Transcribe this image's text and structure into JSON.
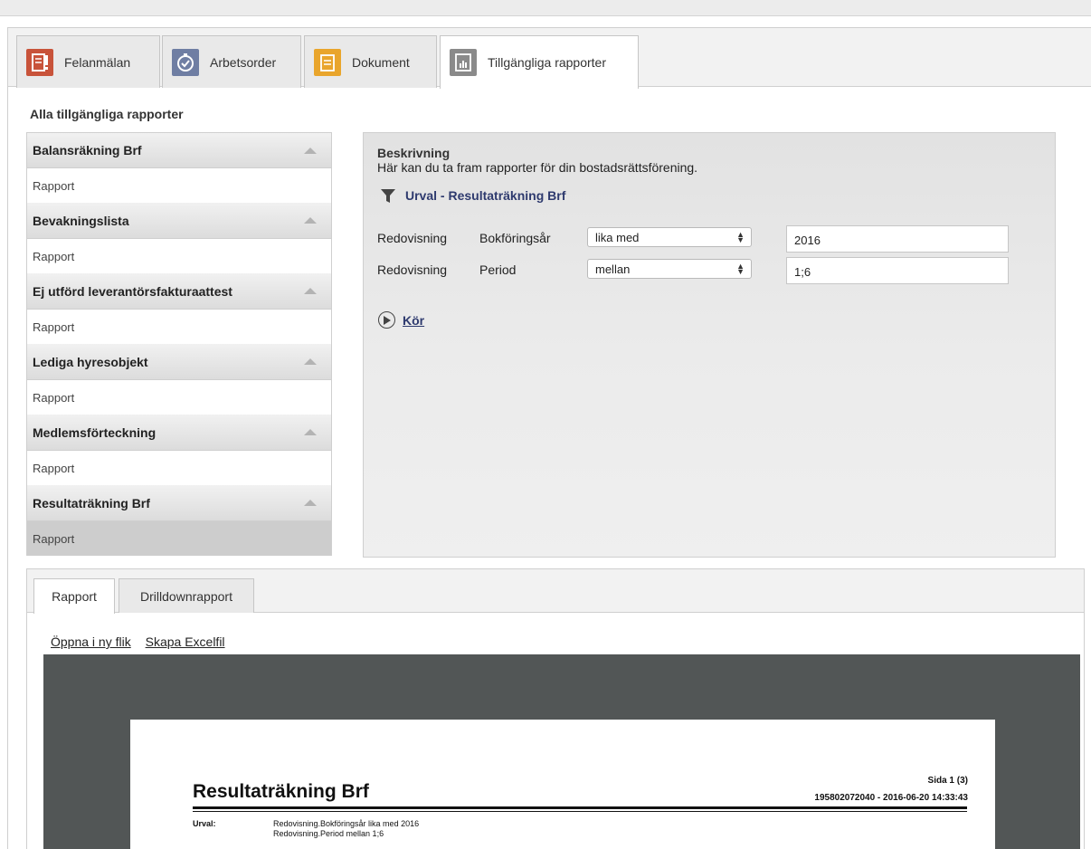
{
  "tabs": [
    {
      "label": "Felanmälan",
      "icon": "alert-document-icon",
      "color": "#c8533a"
    },
    {
      "label": "Arbetsorder",
      "icon": "stopwatch-check-icon",
      "color": "#6f7ea3"
    },
    {
      "label": "Dokument",
      "icon": "document-icon",
      "color": "#e9a52c"
    },
    {
      "label": "Tillgängliga rapporter",
      "icon": "report-chart-icon",
      "color": "#8a8a8a"
    }
  ],
  "section_title": "Alla tillgängliga rapporter",
  "reports": [
    {
      "title": "Balansräkning Brf",
      "item": "Rapport"
    },
    {
      "title": "Bevakningslista",
      "item": "Rapport"
    },
    {
      "title": "Ej utförd leverantörsfakturaattest",
      "item": "Rapport"
    },
    {
      "title": "Lediga hyresobjekt",
      "item": "Rapport"
    },
    {
      "title": "Medlemsförteckning",
      "item": "Rapport"
    },
    {
      "title": "Resultaträkning Brf",
      "item": "Rapport"
    }
  ],
  "panel": {
    "heading": "Beskrivning",
    "description": "Här kan du ta fram rapporter för din bostadsrättsförening.",
    "urval_title": "Urval - Resultaträkning Brf",
    "rows": [
      {
        "c1": "Redovisning",
        "c2": "Bokföringsår",
        "operator": "lika med",
        "value": "2016"
      },
      {
        "c1": "Redovisning",
        "c2": "Period",
        "operator": "mellan",
        "value": "1;6"
      }
    ],
    "run_label": "Kör"
  },
  "viewer": {
    "tabs": [
      "Rapport",
      "Drilldownrapport"
    ],
    "links": [
      "Öppna i ny flik",
      "Skapa Excelfil"
    ],
    "report": {
      "title": "Resultaträkning Brf",
      "page": "Sida 1 (3)",
      "meta": "195802072040 - 2016-06-20 14:33:43",
      "urval_label": "Urval:",
      "urval_lines": [
        "Redovisning.Bokföringsår lika med 2016",
        "Redovisning.Period mellan 1;6"
      ]
    }
  }
}
